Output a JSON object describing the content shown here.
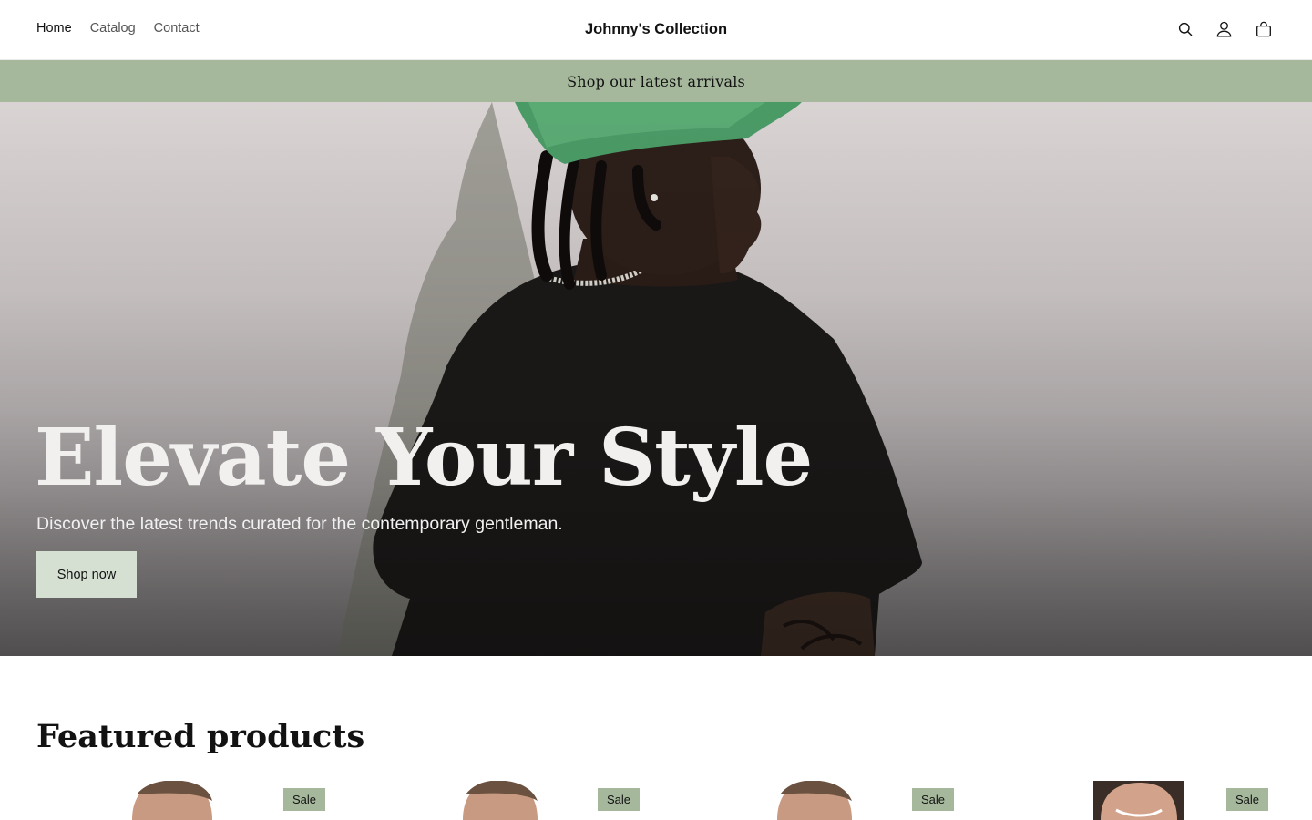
{
  "header": {
    "nav": [
      {
        "label": "Home",
        "active": true
      },
      {
        "label": "Catalog",
        "active": false
      },
      {
        "label": "Contact",
        "active": false
      }
    ],
    "brand": "Johnny's Collection",
    "icons": [
      "search-icon",
      "account-icon",
      "cart-icon"
    ]
  },
  "announcement": {
    "text": "Shop our latest arrivals",
    "background": "#a5b89c"
  },
  "hero": {
    "title": "Elevate Your Style",
    "subtitle": "Discover the latest trends curated for the contemporary gentleman.",
    "button_label": "Shop now",
    "button_color": "#d5dfd2"
  },
  "featured": {
    "title": "Featured products",
    "products": [
      {
        "badge": "Sale"
      },
      {
        "badge": "Sale"
      },
      {
        "badge": "Sale"
      },
      {
        "badge": "Sale"
      }
    ]
  }
}
